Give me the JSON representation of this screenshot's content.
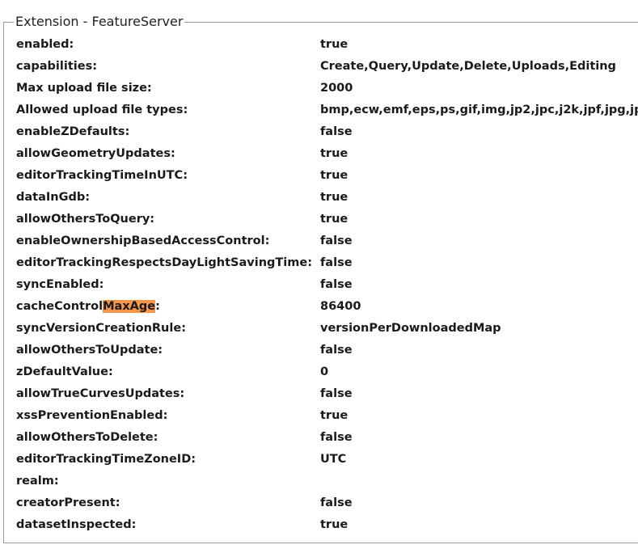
{
  "legend": "Extension - FeatureServer",
  "properties": [
    {
      "key": "enabled:",
      "value": "true"
    },
    {
      "key": "capabilities:",
      "value": "Create,Query,Update,Delete,Uploads,Editing"
    },
    {
      "key": "Max upload file size:",
      "value": "2000"
    },
    {
      "key": "Allowed upload file types:",
      "value": "bmp,ecw,emf,eps,ps,gif,img,jp2,jpc,j2k,jpf,jpg,jp"
    },
    {
      "key": "enableZDefaults:",
      "value": "false"
    },
    {
      "key": "allowGeometryUpdates:",
      "value": "true"
    },
    {
      "key": "editorTrackingTimeInUTC:",
      "value": "true"
    },
    {
      "key": "dataInGdb:",
      "value": "true"
    },
    {
      "key": "allowOthersToQuery:",
      "value": "true"
    },
    {
      "key": "enableOwnershipBasedAccessControl:",
      "value": "false"
    },
    {
      "key": "editorTrackingRespectsDayLightSavingTime:",
      "value": "false"
    },
    {
      "key": "syncEnabled:",
      "value": "false"
    },
    {
      "key_parts": [
        "cacheControl",
        "MaxAge",
        ":"
      ],
      "value": "86400"
    },
    {
      "key": "syncVersionCreationRule:",
      "value": "versionPerDownloadedMap"
    },
    {
      "key": "allowOthersToUpdate:",
      "value": "false"
    },
    {
      "key": "zDefaultValue:",
      "value": "0"
    },
    {
      "key": "allowTrueCurvesUpdates:",
      "value": "false"
    },
    {
      "key": "xssPreventionEnabled:",
      "value": "true"
    },
    {
      "key": "allowOthersToDelete:",
      "value": "false"
    },
    {
      "key": "editorTrackingTimeZoneID:",
      "value": "UTC"
    },
    {
      "key": "realm:",
      "value": ""
    },
    {
      "key": "creatorPresent:",
      "value": "false"
    },
    {
      "key": "datasetInspected:",
      "value": "true"
    }
  ],
  "highlight_color": "#f4974c"
}
